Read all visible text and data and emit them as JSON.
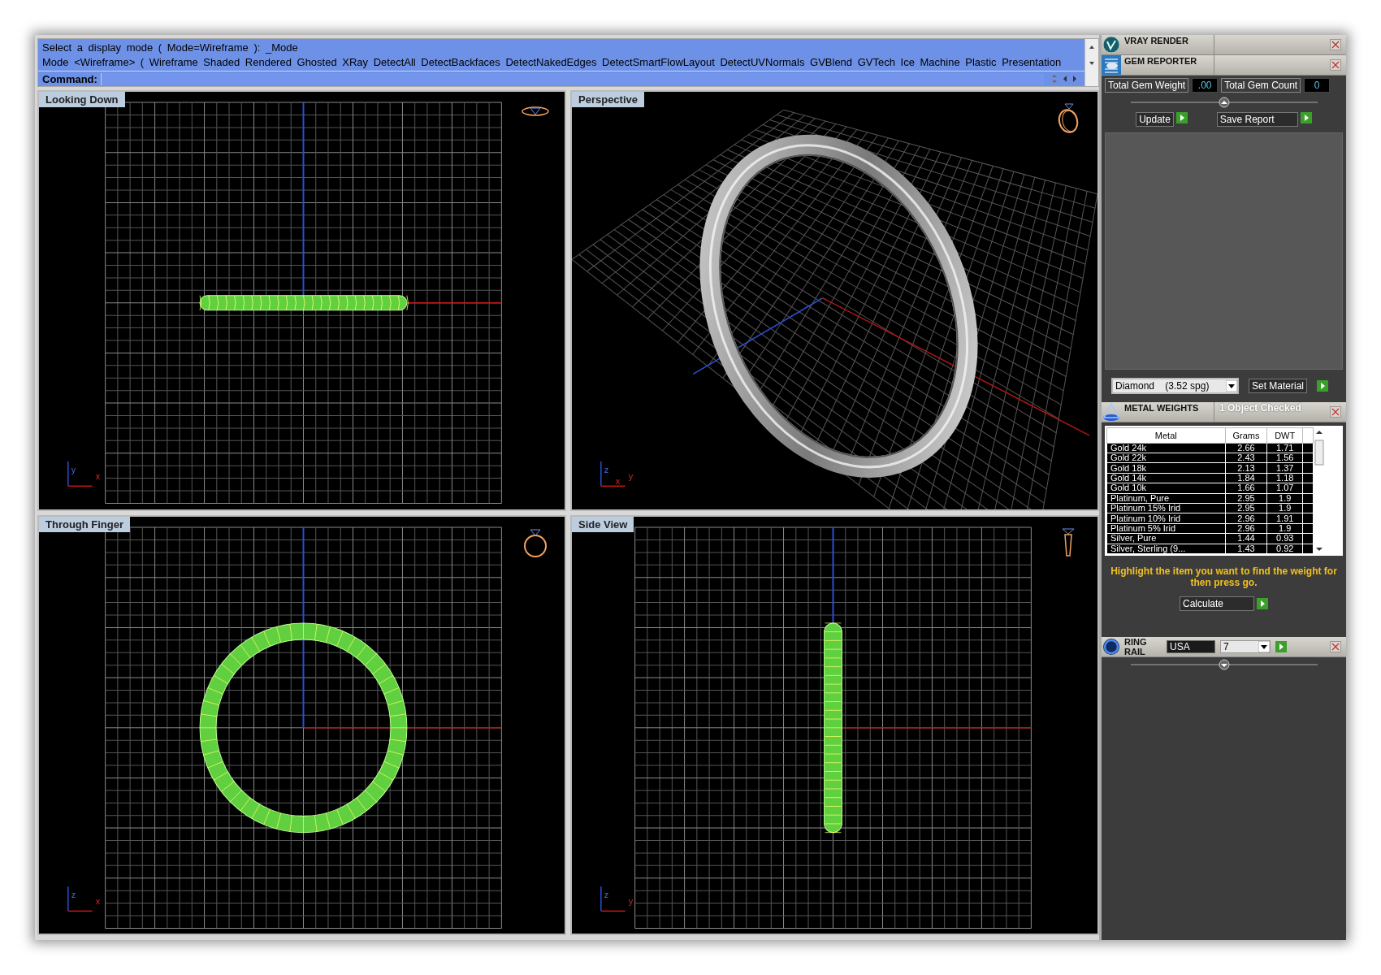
{
  "command": {
    "lines": [
      "Select a display mode ( Mode=Wireframe ): _Mode",
      "Mode <Wireframe> ( Wireframe Shaded Rendered Ghosted XRay DetectAll DetectBackfaces DetectNakedEdges DetectSmartFlowLayout DetectUVNormals GVBlend GVTech Ice Machine Plastic Presentation"
    ],
    "prompt": "Command:"
  },
  "viewports": [
    {
      "title": "Looking Down",
      "kind": "top",
      "axes": [
        "y",
        "x"
      ]
    },
    {
      "title": "Perspective",
      "kind": "perspective",
      "axes": [
        "z",
        "y",
        "x"
      ]
    },
    {
      "title": "Through Finger",
      "kind": "front",
      "axes": [
        "z",
        "x"
      ]
    },
    {
      "title": "Side View",
      "kind": "side",
      "axes": [
        "z",
        "y"
      ]
    }
  ],
  "panels": {
    "vray": {
      "title": "VRAY RENDER"
    },
    "gem_reporter": {
      "title": "GEM REPORTER",
      "weight_label": "Total Gem Weight",
      "weight": ".00",
      "count_label": "Total Gem Count",
      "count": "0",
      "buttons": [
        "Update",
        "Save Report"
      ],
      "material": "Diamond    (3.52 spg)",
      "set_button": "Set Material"
    },
    "metal_weights": {
      "title": "METAL WEIGHTS",
      "status": "1 Object Checked",
      "columns": [
        "Metal",
        "Grams",
        "DWT"
      ],
      "rows": [
        [
          "Gold 24k",
          "2.66",
          "1.71"
        ],
        [
          "Gold 22k",
          "2.43",
          "1.56"
        ],
        [
          "Gold 18k",
          "2.13",
          "1.37"
        ],
        [
          "Gold 14k",
          "1.84",
          "1.18"
        ],
        [
          "Gold 10k",
          "1.66",
          "1.07"
        ],
        [
          "Platinum, Pure",
          "2.95",
          "1.9"
        ],
        [
          "Platinum 15% Irid",
          "2.95",
          "1.9"
        ],
        [
          "Platinum 10% Irid",
          "2.96",
          "1.91"
        ],
        [
          "Platinum 5% Irid",
          "2.96",
          "1.9"
        ],
        [
          "Silver, Pure",
          "1.44",
          "0.93"
        ],
        [
          "Silver, Sterling (9...",
          "1.43",
          "0.92"
        ]
      ],
      "hint": "Highlight the item you want to find the weight for then press go.",
      "button": "Calculate"
    },
    "ring_rail": {
      "title": "RING RAIL",
      "standard": "USA",
      "size": "7"
    }
  }
}
